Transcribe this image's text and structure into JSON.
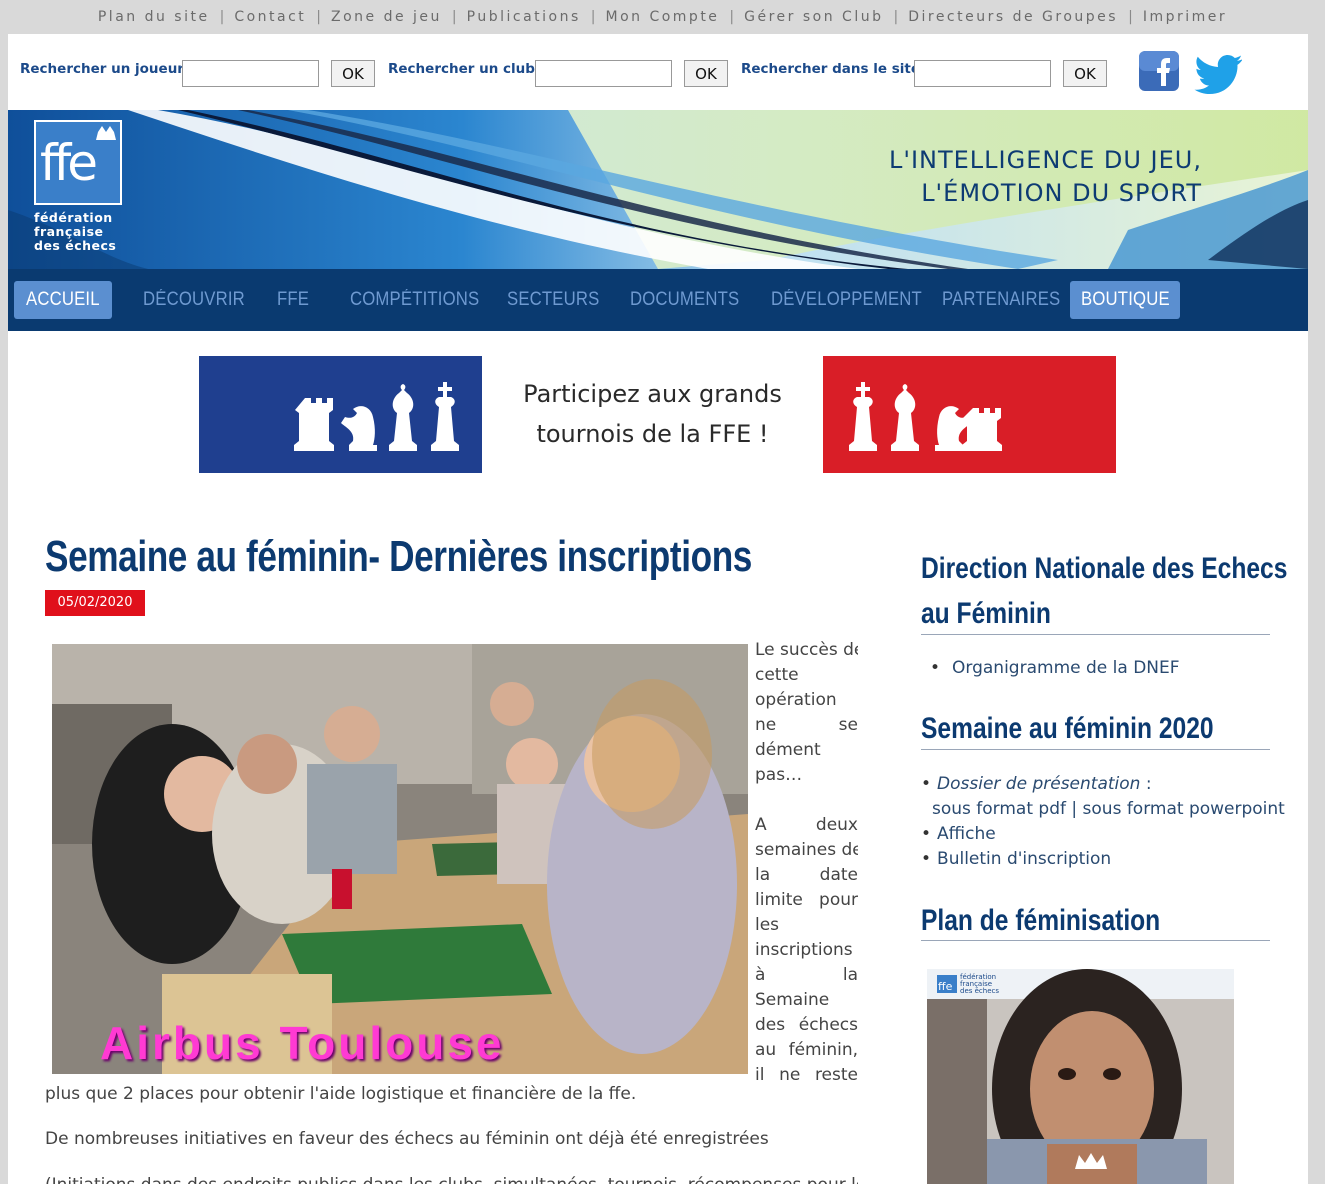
{
  "top_links": [
    "Plan du site",
    "Contact",
    "Zone de jeu",
    "Publications",
    "Mon Compte",
    "Gérer son Club",
    "Directeurs de Groupes",
    "Imprimer"
  ],
  "search": {
    "player_label": "Rechercher un joueur",
    "club_label": "Rechercher un club",
    "site_label": "Rechercher dans le site",
    "ok_label": "OK"
  },
  "banner": {
    "logo_text": "ffe",
    "logo_lines": [
      "fédération",
      "française",
      "des échecs"
    ],
    "tagline_1": "L'INTELLIGENCE DU JEU,",
    "tagline_2": "L'ÉMOTION DU SPORT"
  },
  "nav": [
    "ACCUEIL",
    "DÉCOUVRIR",
    "FFE",
    "COMPÉTITIONS",
    "SECTEURS",
    "DOCUMENTS",
    "DÉVELOPPEMENT",
    "PARTENAIRES",
    "BOUTIQUE"
  ],
  "ad": {
    "line1": "Participez aux grands",
    "line2": "tournois de la FFE !"
  },
  "article": {
    "title": "Semaine au féminin- Dernières inscriptions",
    "date": "05/02/2020",
    "photo_caption": "Airbus Toulouse",
    "side_lines": [
      "Le succès de",
      "cette",
      "opération",
      "ne se",
      "dément",
      "pas…",
      "",
      "A deux",
      "semaines de",
      "la date",
      "limite pour",
      "les",
      "inscriptions",
      "à la",
      "Semaine",
      "des échecs",
      "au féminin,",
      "il ne reste"
    ],
    "continuation": "plus que 2 places pour obtenir l'aide logistique et financière de la ffe.",
    "p2": "De nombreuses initiatives en faveur des échecs au féminin ont déjà été enregistrées",
    "p3": "(Initiations dans des endroits publics,dans les clubs, simultanées, tournois, récompenses pour les"
  },
  "sidebar": {
    "h1_line1": "Direction Nationale des Echecs",
    "h1_line2": "au Féminin",
    "dnef_link": "Organigramme de la DNEF",
    "h2": "Semaine au féminin 2020",
    "dossier": "Dossier de présentation",
    "dossier_suffix": " :",
    "pdf_link": "sous format pdf",
    "pipe": " | ",
    "ppt_link": "sous format powerpoint",
    "affiche": "Affiche",
    "bulletin": "Bulletin d'inscription",
    "h3": "Plan de féminisation",
    "cover_logo": "ffe",
    "cover_lines": [
      "fédération",
      "française",
      "des échecs"
    ]
  },
  "colors": {
    "navy": "#0a3a70",
    "nav_active": "#5b8fd0",
    "date_red": "#e0101b",
    "ad_blue": "#1f3f8f",
    "ad_red": "#d91e27"
  }
}
